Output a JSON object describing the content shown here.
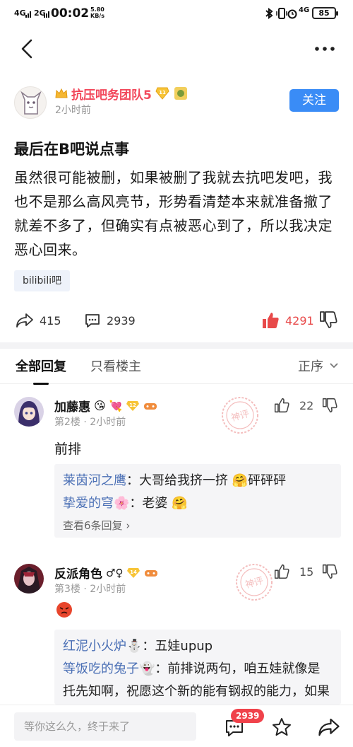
{
  "status": {
    "signal1": "4G",
    "signal2": "2G",
    "time": "00:02",
    "speed_value": "5.80",
    "speed_unit": "KB/s",
    "network": "4G",
    "battery": "85"
  },
  "post": {
    "author": "抗压吧务团队5",
    "level": "11",
    "time": "2小时前",
    "follow_label": "关注",
    "title": "最后在B吧说点事",
    "body": "虽然很可能被删，如果被删了我就去抗吧发吧，我也不是那么高风亮节，形势看清楚本来就准备撤了就差不多了，但确实有点被恶心到了，所以我决定恶心回来。",
    "tag": "bilibili吧",
    "share_count": "415",
    "comment_count": "2939",
    "like_count": "4291"
  },
  "tabs": {
    "all": "全部回复",
    "owner_only": "只看楼主",
    "sort": "正序"
  },
  "comments": [
    {
      "name": "加藤惠",
      "level": "12",
      "floor": "第2楼",
      "time": "2小时前",
      "likes": "22",
      "body": "前排",
      "stamp": "神评",
      "replies": [
        {
          "name": "莱茵河之鹰",
          "text": "大哥给我挤一挤",
          "suffix": "砰砰砰"
        },
        {
          "name": "挚爱的穹",
          "text": "老婆",
          "suffix": ""
        }
      ],
      "more_replies": "查看6条回复"
    },
    {
      "name": "反派角色",
      "name_suffix": "♂♀",
      "level": "14",
      "floor": "第3楼",
      "time": "2小时前",
      "likes": "15",
      "stamp": "神评",
      "replies": [
        {
          "name": "红泥小火炉",
          "text": "五娃upup"
        },
        {
          "name": "等饭吃的兔子",
          "text": "前排说两句，咱五娃就像是托先知啊，祝愿这个新的能有钢叔的能力，如果没能力，那就是吐利物的芸春"
        }
      ]
    }
  ],
  "bottom": {
    "placeholder": "等你这么久，终于来了",
    "comment_badge": "2939"
  },
  "colors": {
    "accent": "#3a8cf6",
    "like_red": "#e84a4a",
    "name_red": "#f2485b",
    "reply_name": "#4a6fb5"
  }
}
